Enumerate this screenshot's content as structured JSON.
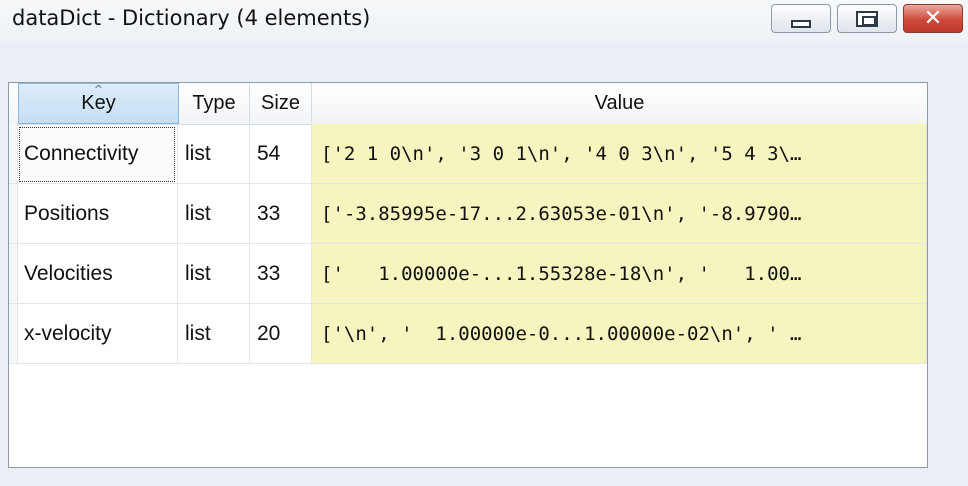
{
  "window": {
    "title": "dataDict - Dictionary (4 elements)",
    "buttons": {
      "minimize": "minimize-icon",
      "maximize": "maximize-icon",
      "close": "close-icon"
    }
  },
  "table": {
    "columns": [
      "Key",
      "Type",
      "Size",
      "Value"
    ],
    "sorted_column": "Key",
    "rows": [
      {
        "key": "Connectivity",
        "type": "list",
        "size": "54",
        "value": "['2 1 0\\n', '3 0 1\\n', '4 0 3\\n', '5 4 3\\…"
      },
      {
        "key": "Positions",
        "type": "list",
        "size": "33",
        "value": "['-3.85995e-17...2.63053e-01\\n', '-8.9790…"
      },
      {
        "key": "Velocities",
        "type": "list",
        "size": "33",
        "value": "['   1.00000e-...1.55328e-18\\n', '   1.00…"
      },
      {
        "key": "x-velocity",
        "type": "list",
        "size": "20",
        "value": "['\\n', '  1.00000e-0...1.00000e-02\\n', ' …"
      }
    ]
  },
  "colors": {
    "value_cell_bg": "#f7f5bf",
    "header_selected_bg": "#c5def4",
    "close_button": "#cf4a3c"
  }
}
